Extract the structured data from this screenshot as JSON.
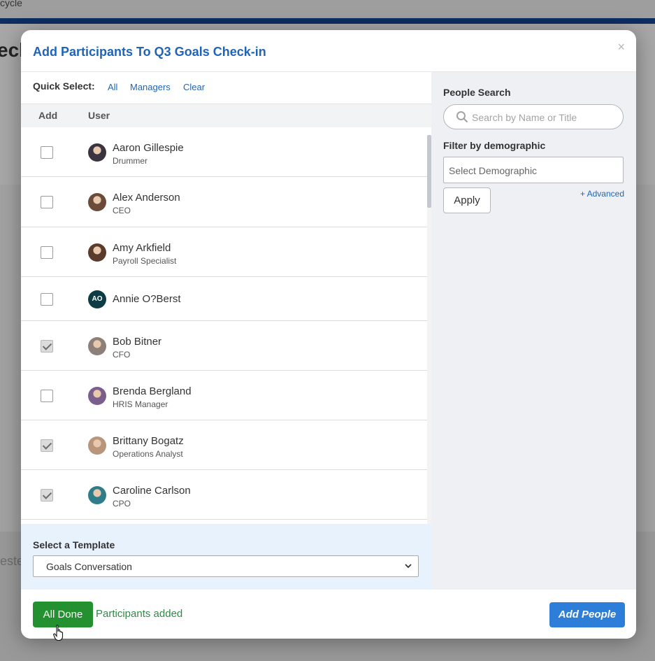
{
  "background": {
    "topbar_text": "cycle",
    "heading_fragment": "eck",
    "ghost_text": "este"
  },
  "modal": {
    "title": "Add Participants To Q3 Goals Check-in",
    "close_glyph": "×"
  },
  "quick_select": {
    "label": "Quick Select:",
    "all": "All",
    "managers": "Managers",
    "clear": "Clear"
  },
  "table": {
    "col_add": "Add",
    "col_user": "User",
    "rows": [
      {
        "name": "Aaron Gillespie",
        "title": "Drummer",
        "checked": false,
        "avatar": "photo",
        "avatar_color": "#3b3440"
      },
      {
        "name": "Alex Anderson",
        "title": "CEO",
        "checked": false,
        "avatar": "photo",
        "avatar_color": "#6b4a3a"
      },
      {
        "name": "Amy Arkfield",
        "title": "Payroll Specialist",
        "checked": false,
        "avatar": "photo",
        "avatar_color": "#5a3b2c"
      },
      {
        "name": "Annie O?Berst",
        "title": "",
        "checked": false,
        "avatar": "initials",
        "initials": "AO",
        "avatar_color": "#0e3c44"
      },
      {
        "name": "Bob Bitner",
        "title": "CFO",
        "checked": true,
        "avatar": "photo",
        "avatar_color": "#8c8079"
      },
      {
        "name": "Brenda Bergland",
        "title": "HRIS Manager",
        "checked": false,
        "avatar": "photo",
        "avatar_color": "#7a5f8c"
      },
      {
        "name": "Brittany Bogatz",
        "title": "Operations Analyst",
        "checked": true,
        "avatar": "photo",
        "avatar_color": "#b7967c"
      },
      {
        "name": "Caroline Carlson",
        "title": "CPO",
        "checked": true,
        "avatar": "photo",
        "avatar_color": "#2f7d8a"
      }
    ]
  },
  "template": {
    "label": "Select a Template",
    "selected": "Goals Conversation"
  },
  "search": {
    "label": "People Search",
    "placeholder": "Search by Name or Title"
  },
  "filter": {
    "label": "Filter by demographic",
    "placeholder": "Select Demographic",
    "advanced": "+ Advanced",
    "apply": "Apply"
  },
  "footer": {
    "all_done": "All Done",
    "status": "Participants added",
    "add_people": "Add People"
  },
  "colors": {
    "title_blue": "#1f64b8",
    "link_blue": "#2266b0",
    "done_green": "#23912f",
    "status_green": "#2e8a44",
    "primary_blue": "#2d7ed9"
  }
}
